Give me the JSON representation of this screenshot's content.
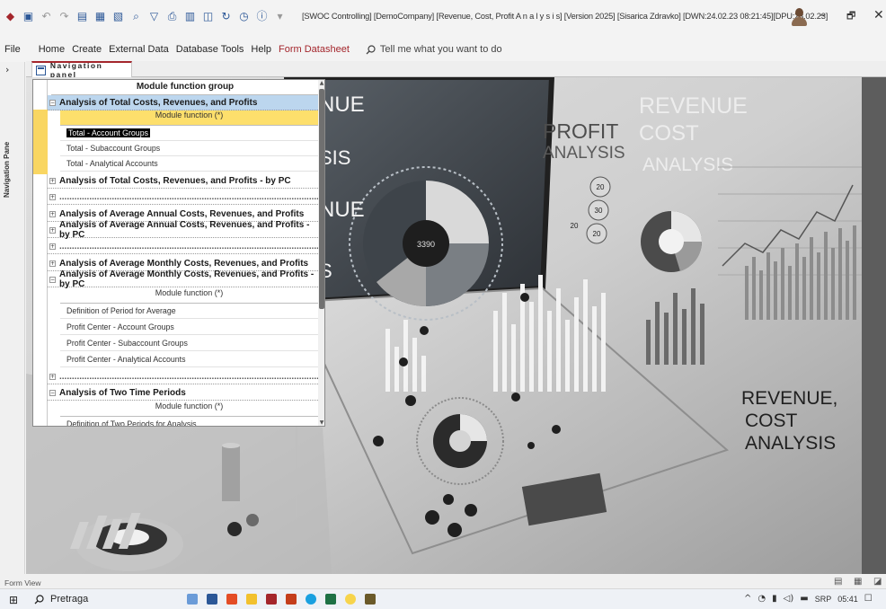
{
  "window": {
    "title": "[SWOC Controlling] [DemoCompany] [Revenue, Cost, Profit  A n a l y s i s] [Version 2025] [Sisarica Zdravko] [DWN:24.02.23 08:21:45][DPU:23.02.23]",
    "controls": {
      "minimize": "–",
      "restore": "🗗",
      "close": "✕"
    }
  },
  "quick_access": {
    "icons": [
      "access-logo-icon",
      "save-icon",
      "undo-icon",
      "redo-icon",
      "form-icon",
      "datasheet-icon",
      "report-icon",
      "search-icon",
      "filter-icon",
      "print-icon",
      "table-icon",
      "split-icon",
      "refresh-icon",
      "clock-icon",
      "info-icon",
      "customize-icon"
    ]
  },
  "menu": {
    "file": "File",
    "home": "Home",
    "create": "Create",
    "external_data": "External Data",
    "database_tools": "Database Tools",
    "help": "Help",
    "form_datasheet": "Form Datasheet",
    "tell_me": "Tell me what you want to do"
  },
  "nav_pane_label": "Navigation Pane",
  "document_tab": "Navigation panel",
  "navigation": {
    "header": "Module function group",
    "groups": [
      {
        "label": "Analysis of Total Costs, Revenues, and Profits",
        "toggle": "−",
        "highlighted": true
      },
      {
        "label": "Analysis of Total Costs, Revenues, and Profits - by PC",
        "toggle": "+"
      },
      {
        "label": "Analysis of Average Annual Costs, Revenues, and Profits",
        "toggle": "+"
      },
      {
        "label": "Analysis of Average Annual Costs, Revenues, and Profits - by PC",
        "toggle": "+"
      },
      {
        "label": "Analysis of Average Monthly Costs, Revenues, and Profits",
        "toggle": "+"
      },
      {
        "label": "Analysis of Average Monthly Costs, Revenues, and Profits - by PC",
        "toggle": "−"
      },
      {
        "label": "Analysis of Two Time Periods",
        "toggle": "−"
      }
    ],
    "separator": "........................................................................................................................",
    "function_header": "Module function (*)",
    "group1_items": [
      "Total - Account Groups",
      "Total - Subaccount Groups",
      "Total - Analytical Accounts"
    ],
    "group6_items": [
      "Definition of Period for Average",
      "Profit Center - Account Groups",
      "Profit Center - Subaccount Groups",
      "Profit Center - Analytical Accounts"
    ],
    "group7_items": [
      "Definition of Two Periods for Analysis"
    ]
  },
  "background_texts": {
    "nue1": "NUE",
    "sis": "SIS",
    "nue2": "NUE",
    "s": "S",
    "profit": "PROFIT",
    "analysis_small": "ANALYSIS",
    "revenue": "REVENUE",
    "cost": "COST",
    "analysis": "ANALYSIS",
    "revenue2": "REVENUE,",
    "cost2": "COST",
    "analysis2": "ANALYSIS",
    "center_value": "3390",
    "badge1": "20",
    "badge2": "30",
    "badge3": "20",
    "badge4": "20"
  },
  "status": {
    "form_view": "Form View"
  },
  "taskbar": {
    "search": "Pretraga",
    "lang": "SRP",
    "time": "05:41"
  },
  "colors": {
    "accent": "#a4262c",
    "selected_group": "#bcd6ee",
    "function_header": "#fddf6c",
    "record_selector": "#f9d662"
  }
}
